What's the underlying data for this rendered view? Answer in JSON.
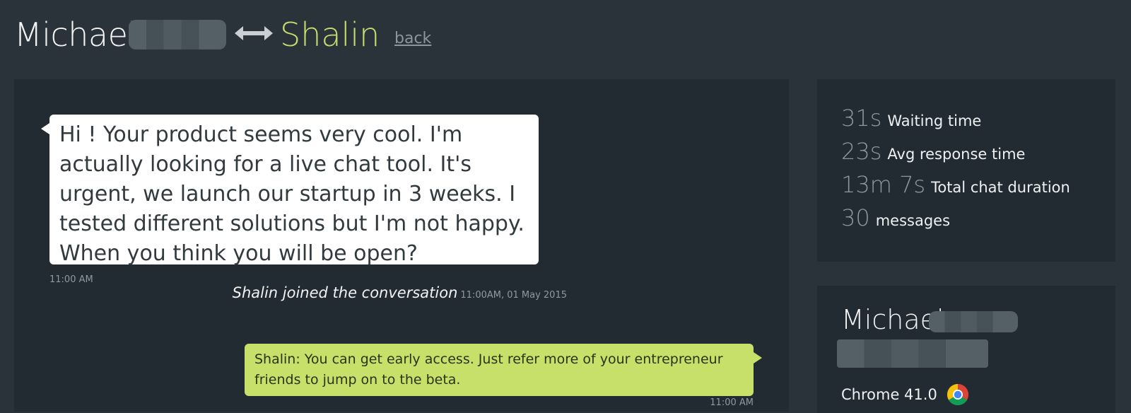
{
  "header": {
    "visitor_name": "Michael",
    "agent_name": "Shalin",
    "back_label": "back"
  },
  "chat": {
    "incoming": {
      "text": "Hi ! Your product seems very cool. I'm actually looking for a live chat tool. It's urgent, we launch our startup in 3 weeks. I tested different solutions but I'm not happy. When you think you will be open?",
      "time": "11:00 AM"
    },
    "event": {
      "text": "Shalin joined the conversation",
      "time": "11:00AM, 01 May 2015"
    },
    "outgoing": {
      "text": "Shalin: You can get early access. Just refer more of your entrepreneur friends to jump on to the beta.",
      "time": "11:00 AM"
    }
  },
  "stats": [
    {
      "value": "31s",
      "label": "Waiting time"
    },
    {
      "value": "23s",
      "label": "Avg response time"
    },
    {
      "value": "13m 7s",
      "label": "Total chat duration"
    },
    {
      "value": "30",
      "label": "messages"
    }
  ],
  "visitor": {
    "name": "Michael",
    "browser": "Chrome 41.0",
    "browser_icon": "chrome-icon"
  },
  "colors": {
    "background": "#2a3339",
    "panel": "#222b31",
    "accent": "#c6de6e",
    "outgoing_bubble": "#c6e06a",
    "incoming_bubble": "#ffffff"
  }
}
